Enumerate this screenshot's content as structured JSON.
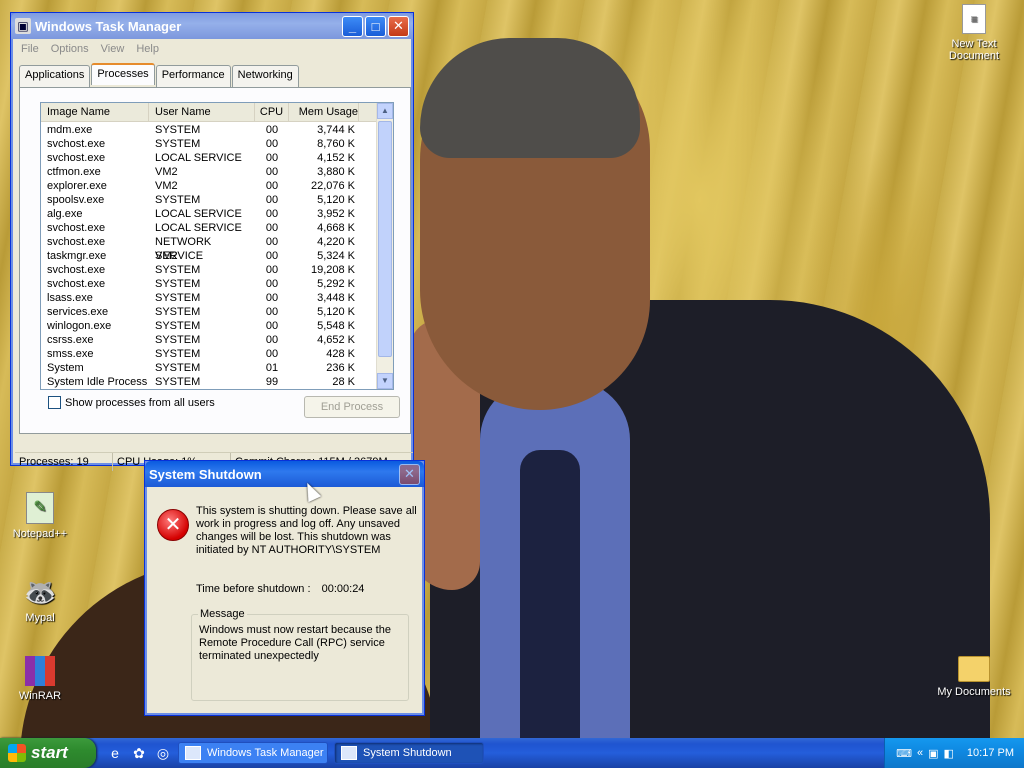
{
  "desktop": {
    "icons": [
      {
        "label": "New Text Document",
        "icon": "text-document-icon"
      },
      {
        "label": "Notepad++",
        "icon": "notepadpp-icon"
      },
      {
        "label": "Mypal",
        "icon": "mypal-icon"
      },
      {
        "label": "WinRAR",
        "icon": "winrar-icon"
      },
      {
        "label": "My Documents",
        "icon": "my-documents-icon"
      }
    ]
  },
  "task_manager": {
    "title": "Windows Task Manager",
    "menu": [
      "File",
      "Options",
      "View",
      "Help"
    ],
    "tabs": [
      "Applications",
      "Processes",
      "Performance",
      "Networking"
    ],
    "active_tab": "Processes",
    "columns": [
      "Image Name",
      "User Name",
      "CPU",
      "Mem Usage"
    ],
    "rows": [
      [
        "mdm.exe",
        "SYSTEM",
        "00",
        "3,744 K"
      ],
      [
        "svchost.exe",
        "SYSTEM",
        "00",
        "8,760 K"
      ],
      [
        "svchost.exe",
        "LOCAL SERVICE",
        "00",
        "4,152 K"
      ],
      [
        "ctfmon.exe",
        "VM2",
        "00",
        "3,880 K"
      ],
      [
        "explorer.exe",
        "VM2",
        "00",
        "22,076 K"
      ],
      [
        "spoolsv.exe",
        "SYSTEM",
        "00",
        "5,120 K"
      ],
      [
        "alg.exe",
        "LOCAL SERVICE",
        "00",
        "3,952 K"
      ],
      [
        "svchost.exe",
        "LOCAL SERVICE",
        "00",
        "4,668 K"
      ],
      [
        "svchost.exe",
        "NETWORK SERVICE",
        "00",
        "4,220 K"
      ],
      [
        "taskmgr.exe",
        "VM2",
        "00",
        "5,324 K"
      ],
      [
        "svchost.exe",
        "SYSTEM",
        "00",
        "19,208 K"
      ],
      [
        "svchost.exe",
        "SYSTEM",
        "00",
        "5,292 K"
      ],
      [
        "lsass.exe",
        "SYSTEM",
        "00",
        "3,448 K"
      ],
      [
        "services.exe",
        "SYSTEM",
        "00",
        "5,120 K"
      ],
      [
        "winlogon.exe",
        "SYSTEM",
        "00",
        "5,548 K"
      ],
      [
        "csrss.exe",
        "SYSTEM",
        "00",
        "4,652 K"
      ],
      [
        "smss.exe",
        "SYSTEM",
        "00",
        "428 K"
      ],
      [
        "System",
        "SYSTEM",
        "01",
        "236 K"
      ],
      [
        "System Idle Process",
        "SYSTEM",
        "99",
        "28 K"
      ]
    ],
    "show_all_label": "Show processes from all users",
    "end_process_label": "End Process",
    "status": {
      "processes": "Processes: 19",
      "cpu": "CPU Usage: 1%",
      "commit": "Commit Charge: 115M / 3679M"
    }
  },
  "shutdown_dialog": {
    "title": "System Shutdown",
    "message": "This system is shutting down. Please save all work in progress and log off. Any unsaved changes will be lost. This shutdown was initiated by NT AUTHORITY\\SYSTEM",
    "timer_label": "Time before shutdown :",
    "timer_value": "00:00:24",
    "group_label": "Message",
    "group_text": "Windows must now restart because the Remote Procedure Call (RPC) service terminated unexpectedly"
  },
  "taskbar": {
    "start_label": "start",
    "items": [
      {
        "label": "Windows Task Manager",
        "active": false
      },
      {
        "label": "System Shutdown",
        "active": true
      }
    ],
    "clock": "10:17 PM"
  },
  "colors": {
    "titlebar_blue": "#0a5bdf",
    "taskbar_blue": "#245edb",
    "start_green": "#2e8b2e",
    "error_red": "#d40000"
  }
}
